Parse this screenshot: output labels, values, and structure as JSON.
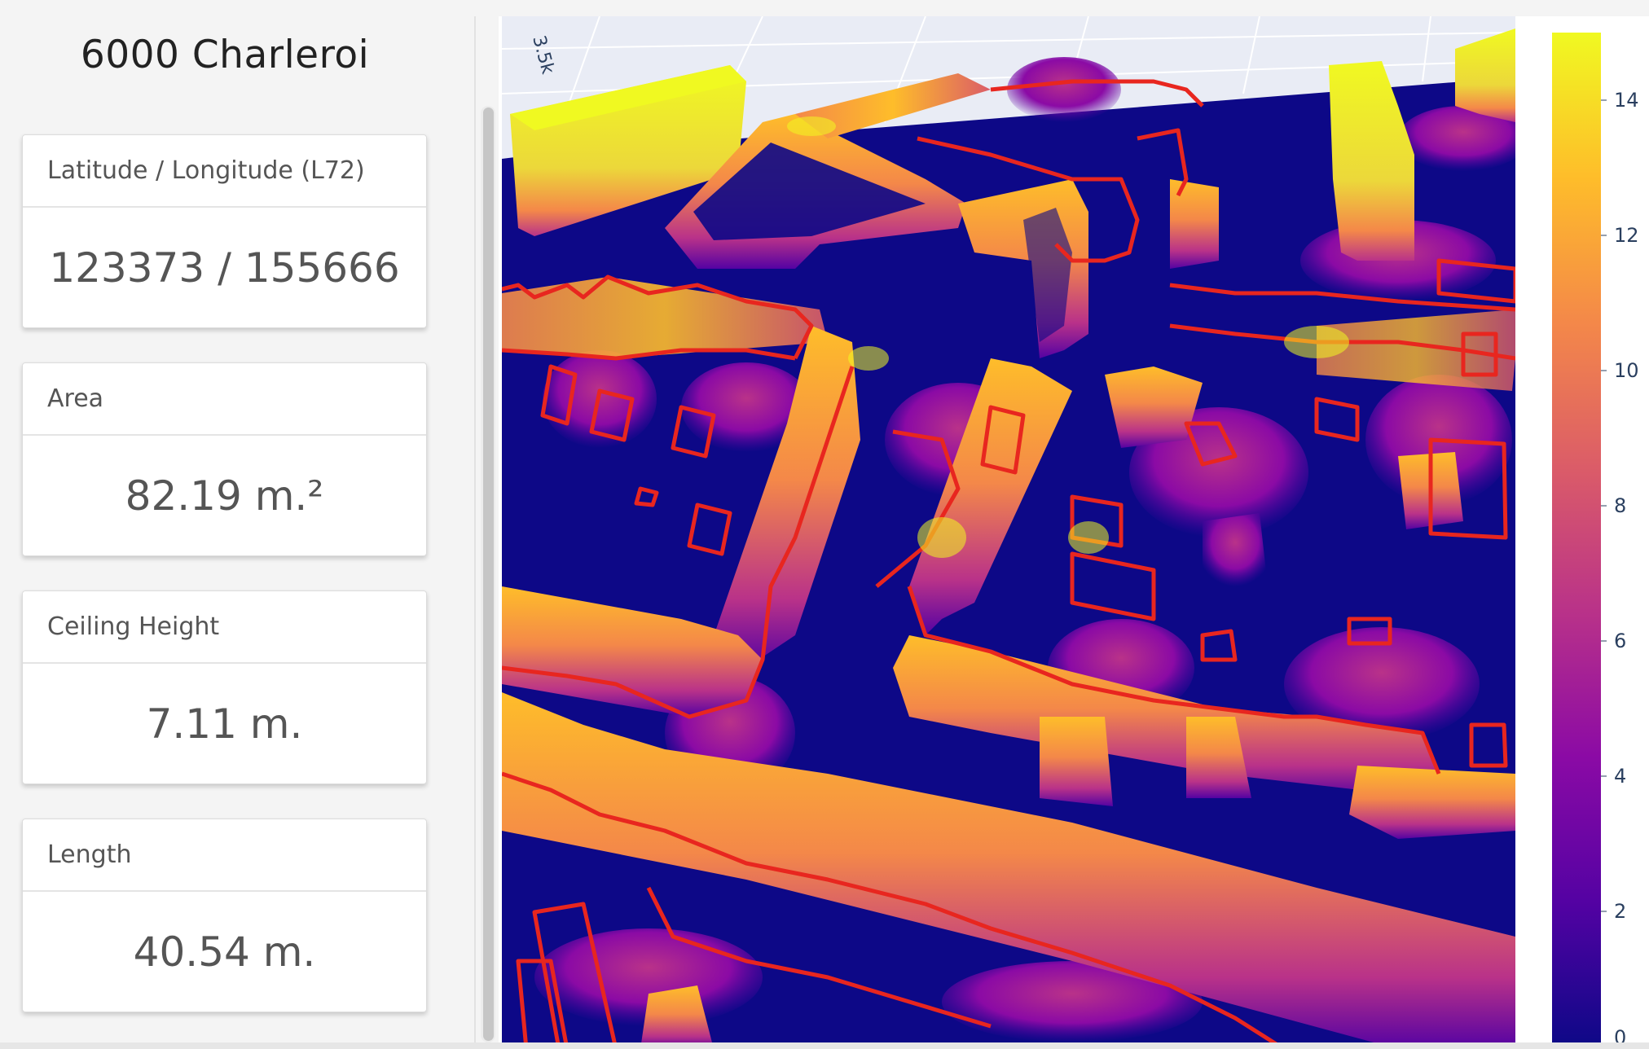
{
  "sidebar": {
    "title": "6000 Charleroi",
    "cards": [
      {
        "label": "Latitude / Longitude (L72)",
        "value": "123373 / 155666"
      },
      {
        "label": "Area",
        "value": "82.19 m.²"
      },
      {
        "label": "Ceiling Height",
        "value": "7.11 m."
      },
      {
        "label": "Length",
        "value": "40.54 m."
      }
    ]
  },
  "plot": {
    "axis_fragment": "3.5k",
    "colorscale": [
      "#0d0887",
      "#5402a3",
      "#8b0aa5",
      "#b93289",
      "#db5c68",
      "#f48849",
      "#febd2a",
      "#f0f921"
    ],
    "colorbar_ticks": [
      "14",
      "12",
      "10",
      "8",
      "6",
      "4",
      "2",
      "0"
    ],
    "colorbar_range": [
      0,
      15
    ],
    "outline_color": "#e8261f"
  }
}
